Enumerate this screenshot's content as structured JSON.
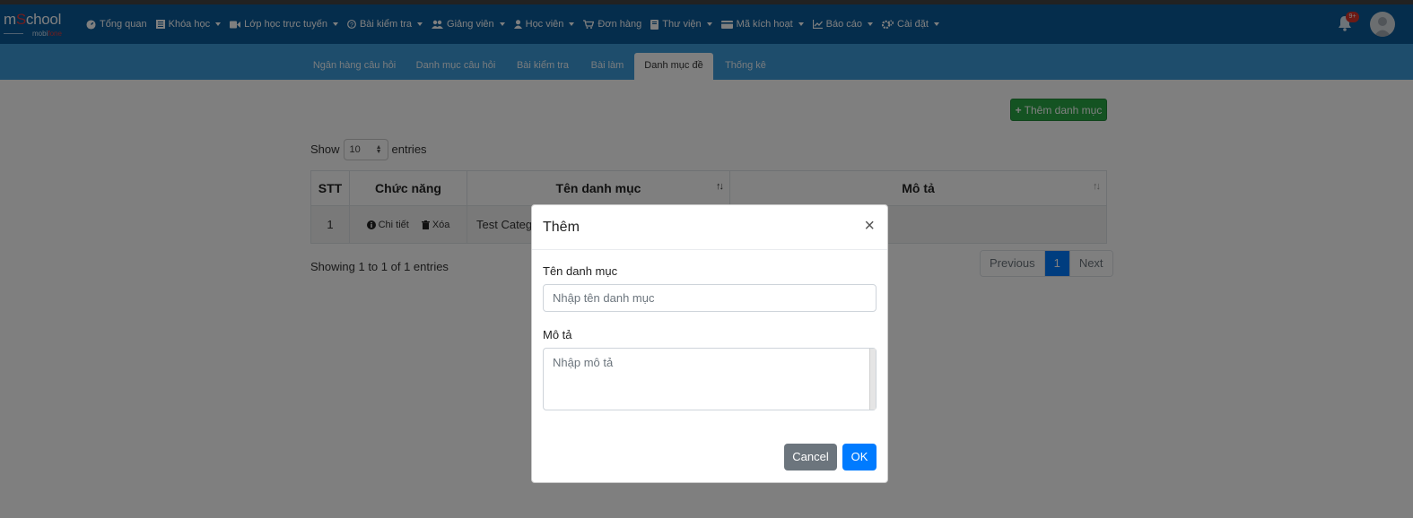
{
  "brand": {
    "logo_main": "m",
    "logo_accent": "S",
    "logo_rest": "chool",
    "logo_sub_a": "mobi",
    "logo_sub_b": "fone"
  },
  "nav": {
    "items": [
      {
        "label": "Tổng quan",
        "icon": "dashboard-icon",
        "dropdown": false
      },
      {
        "label": "Khóa học",
        "icon": "list-icon",
        "dropdown": true
      },
      {
        "label": "Lớp học trực tuyến",
        "icon": "video-icon",
        "dropdown": true
      },
      {
        "label": "Bài kiểm tra",
        "icon": "question-icon",
        "dropdown": true
      },
      {
        "label": "Giảng viên",
        "icon": "users-icon",
        "dropdown": true
      },
      {
        "label": "Học viên",
        "icon": "user-icon",
        "dropdown": true
      },
      {
        "label": "Đơn hàng",
        "icon": "cart-icon",
        "dropdown": false
      },
      {
        "label": "Thư viện",
        "icon": "book-icon",
        "dropdown": true
      },
      {
        "label": "Mã kích hoạt",
        "icon": "card-icon",
        "dropdown": true
      },
      {
        "label": "Báo cáo",
        "icon": "chart-icon",
        "dropdown": true
      },
      {
        "label": "Cài đặt",
        "icon": "gears-icon",
        "dropdown": true
      }
    ],
    "notification_badge": "9+"
  },
  "tabs": [
    {
      "label": "Ngân hàng câu hỏi"
    },
    {
      "label": "Danh mục câu hỏi"
    },
    {
      "label": "Bài kiểm tra"
    },
    {
      "label": "Bài làm"
    },
    {
      "label": "Danh mục đề"
    },
    {
      "label": "Thống kê"
    }
  ],
  "page": {
    "add_button": "Thêm danh mục",
    "show_label": "Show",
    "entries_value": "10",
    "entries_label": "entries",
    "table": {
      "headers": [
        "STT",
        "Chức năng",
        "Tên danh mục",
        "Mô tả"
      ],
      "rows": [
        {
          "stt": "1",
          "detail": "Chi tiết",
          "delete": "Xóa",
          "name": "Test Categ",
          "desc": ""
        }
      ]
    },
    "showing": "Showing 1 to 1 of 1 entries",
    "pager": {
      "previous": "Previous",
      "current": "1",
      "next": "Next"
    }
  },
  "modal": {
    "title": "Thêm",
    "close": "×",
    "name_label": "Tên danh mục",
    "name_placeholder": "Nhập tên danh mục",
    "desc_label": "Mô tả",
    "desc_placeholder": "Nhập mô tả",
    "cancel": "Cancel",
    "ok": "OK"
  }
}
